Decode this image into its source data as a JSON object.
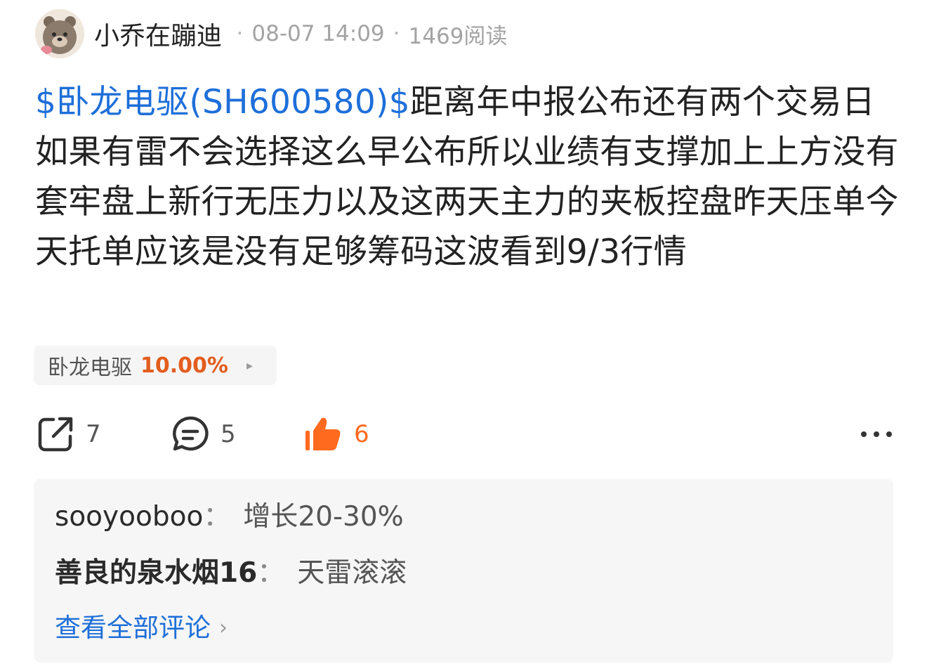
{
  "header": {
    "username": "小乔在蹦迪",
    "separator": "·",
    "datetime": "08-07 14:09",
    "reads": "1469阅读",
    "avatar_icon": "bear-avatar-icon"
  },
  "post": {
    "stock_link": "$卧龙电驱(SH600580)$",
    "text": "距离年中报公布还有两个交易日如果有雷不会选择这么早公布所以业绩有支撑加上上方没有套牢盘上新行无压力以及这两天主力的夹板控盘昨天压单今天托单应该是没有足够筹码这波看到9/3行情"
  },
  "stock_chip": {
    "name": "卧龙电驱",
    "change": "10.00%",
    "arrow": "▸",
    "change_color": "#e35d1e"
  },
  "actions": {
    "share": {
      "icon": "share-icon",
      "count": "7"
    },
    "comment": {
      "icon": "comment-icon",
      "count": "5"
    },
    "like": {
      "icon": "thumbs-up-icon",
      "count": "6",
      "color": "#ff6a1f"
    },
    "more": {
      "icon": "more-icon"
    }
  },
  "comments": {
    "items": [
      {
        "author": "sooyooboo",
        "sep": "：",
        "text": "增长20-30%"
      },
      {
        "author": "善良的泉水烟16",
        "sep": "：",
        "text": "天雷滚滚"
      }
    ],
    "view_all": "查看全部评论",
    "view_all_chevron": "›"
  },
  "colors": {
    "link": "#1e6fd9",
    "accent": "#ff6a1f",
    "muted": "#a3a3a3"
  }
}
